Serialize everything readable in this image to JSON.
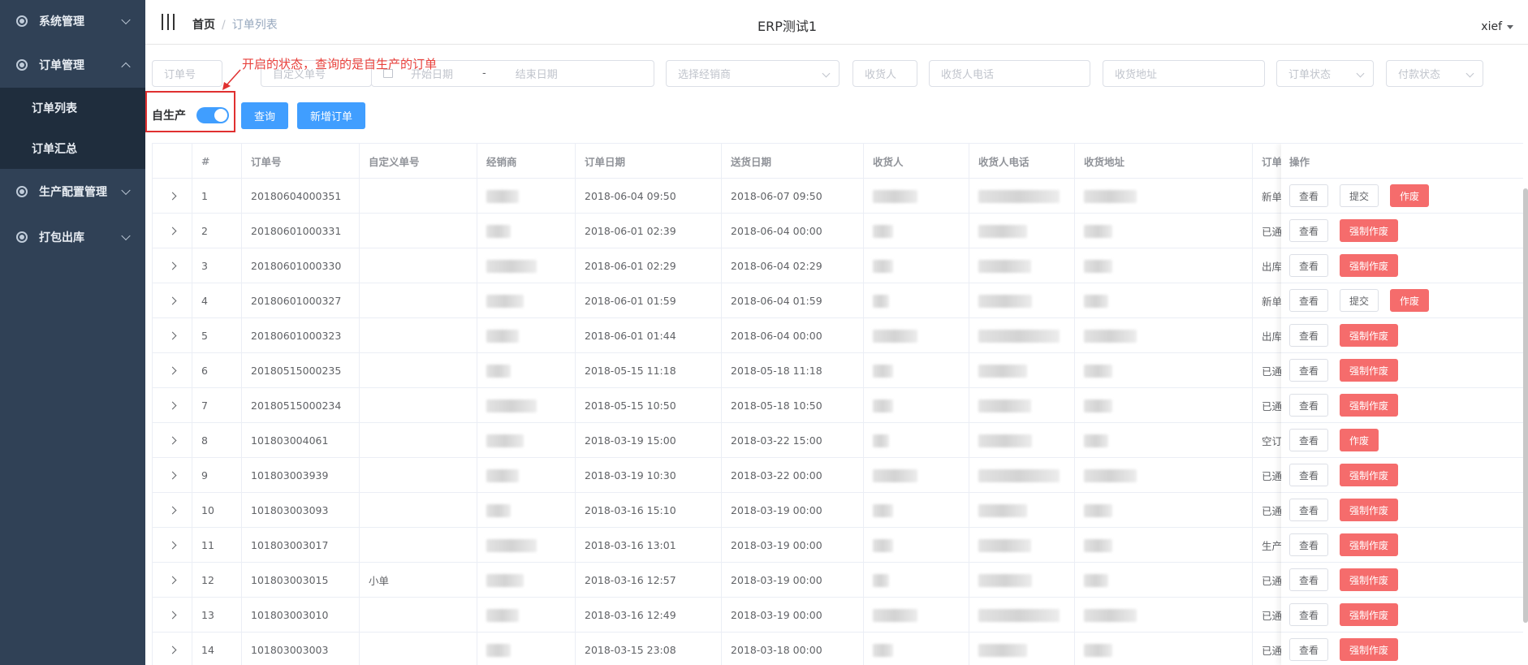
{
  "sidebar": {
    "groups": [
      {
        "label": "系统管理",
        "icon": "gear-icon"
      },
      {
        "label": "订单管理",
        "icon": "gear-icon"
      },
      {
        "label": "生产配置管理",
        "icon": "gear-icon"
      },
      {
        "label": "打包出库",
        "icon": "gear-icon"
      }
    ],
    "order_submenu": [
      {
        "label": "订单列表"
      },
      {
        "label": "订单汇总"
      }
    ]
  },
  "header": {
    "breadcrumb_home": "首页",
    "breadcrumb_sep": "/",
    "breadcrumb_current": "订单列表",
    "app_title": "ERP测试1",
    "username": "xief"
  },
  "filters": {
    "order_no": "订单号",
    "custom_no": "自定义单号",
    "start_date": "开始日期",
    "date_sep": "-",
    "end_date": "结束日期",
    "dealer": "选择经销商",
    "receiver": "收货人",
    "receiver_phone": "收货人电话",
    "receiver_address": "收货地址",
    "order_status": "订单状态",
    "pay_status": "付款状态"
  },
  "toolbar": {
    "switch_label": "自生产",
    "search_button": "查询",
    "add_button": "新增订单"
  },
  "annotation": "开启的状态，查询的是自生产的订单",
  "table": {
    "headers": [
      "#",
      "订单号",
      "自定义单号",
      "经销商",
      "订单日期",
      "送货日期",
      "收货人",
      "收货人电话",
      "收货地址",
      "订单状态",
      "操作"
    ],
    "rows": [
      {
        "index": "1",
        "order_no": "20180604000351",
        "custom_no": "",
        "order_date": "2018-06-04 09:50",
        "delivery_date": "2018-06-07 09:50",
        "status": "新单",
        "actions": [
          "查看",
          "提交",
          "作废"
        ]
      },
      {
        "index": "2",
        "order_no": "20180601000331",
        "custom_no": "",
        "order_date": "2018-06-01 02:39",
        "delivery_date": "2018-06-04 00:00",
        "status": "已通过",
        "actions": [
          "查看",
          "强制作废"
        ]
      },
      {
        "index": "3",
        "order_no": "20180601000330",
        "custom_no": "",
        "order_date": "2018-06-01 02:29",
        "delivery_date": "2018-06-04 02:29",
        "status": "出库完成",
        "actions": [
          "查看",
          "强制作废"
        ]
      },
      {
        "index": "4",
        "order_no": "20180601000327",
        "custom_no": "",
        "order_date": "2018-06-01 01:59",
        "delivery_date": "2018-06-04 01:59",
        "status": "新单",
        "actions": [
          "查看",
          "提交",
          "作废"
        ]
      },
      {
        "index": "5",
        "order_no": "20180601000323",
        "custom_no": "",
        "order_date": "2018-06-01 01:44",
        "delivery_date": "2018-06-04 00:00",
        "status": "出库完成",
        "actions": [
          "查看",
          "强制作废"
        ]
      },
      {
        "index": "6",
        "order_no": "20180515000235",
        "custom_no": "",
        "order_date": "2018-05-15 11:18",
        "delivery_date": "2018-05-18 11:18",
        "status": "已通过",
        "actions": [
          "查看",
          "强制作废"
        ]
      },
      {
        "index": "7",
        "order_no": "20180515000234",
        "custom_no": "",
        "order_date": "2018-05-15 10:50",
        "delivery_date": "2018-05-18 10:50",
        "status": "已通过",
        "actions": [
          "查看",
          "强制作废"
        ]
      },
      {
        "index": "8",
        "order_no": "101803004061",
        "custom_no": "",
        "order_date": "2018-03-19 15:00",
        "delivery_date": "2018-03-22 15:00",
        "status": "空订单",
        "actions": [
          "查看",
          "作废"
        ]
      },
      {
        "index": "9",
        "order_no": "101803003939",
        "custom_no": "",
        "order_date": "2018-03-19 10:30",
        "delivery_date": "2018-03-22 00:00",
        "status": "已通过",
        "actions": [
          "查看",
          "强制作废"
        ]
      },
      {
        "index": "10",
        "order_no": "101803003093",
        "custom_no": "",
        "order_date": "2018-03-16 15:10",
        "delivery_date": "2018-03-19 00:00",
        "status": "已通过",
        "actions": [
          "查看",
          "强制作废"
        ]
      },
      {
        "index": "11",
        "order_no": "101803003017",
        "custom_no": "",
        "order_date": "2018-03-16 13:01",
        "delivery_date": "2018-03-19 00:00",
        "status": "生产完成",
        "actions": [
          "查看",
          "强制作废"
        ]
      },
      {
        "index": "12",
        "order_no": "101803003015",
        "custom_no": "小单",
        "order_date": "2018-03-16 12:57",
        "delivery_date": "2018-03-19 00:00",
        "status": "已通过",
        "actions": [
          "查看",
          "强制作废"
        ]
      },
      {
        "index": "13",
        "order_no": "101803003010",
        "custom_no": "",
        "order_date": "2018-03-16 12:49",
        "delivery_date": "2018-03-19 00:00",
        "status": "已通过",
        "actions": [
          "查看",
          "强制作废"
        ]
      },
      {
        "index": "14",
        "order_no": "101803003003",
        "custom_no": "",
        "order_date": "2018-03-15 23:08",
        "delivery_date": "2018-03-18 00:00",
        "status": "已通过",
        "actions": [
          "查看",
          "强制作废"
        ]
      }
    ]
  },
  "colors": {
    "sidebar_bg": "#304156",
    "primary": "#409eff",
    "danger": "#f56c6c",
    "annotation": "#e03030"
  }
}
